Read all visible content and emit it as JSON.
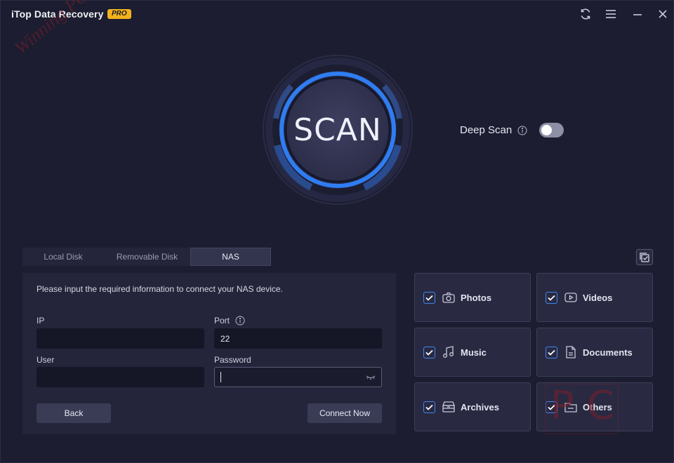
{
  "app": {
    "title": "iTop Data Recovery",
    "badge": "PRO"
  },
  "titlebar": {
    "refresh_icon": "refresh-icon",
    "menu_icon": "menu-icon",
    "minimize_icon": "minimize-icon",
    "close_icon": "close-icon"
  },
  "watermark": {
    "text": "Winning PC",
    "corner": "P C"
  },
  "scan": {
    "label": "SCAN",
    "ring_color": "#2f7df2"
  },
  "deep_scan": {
    "label": "Deep Scan",
    "enabled": false
  },
  "tabs": [
    {
      "label": "Local Disk",
      "active": false
    },
    {
      "label": "Removable Disk",
      "active": false
    },
    {
      "label": "NAS",
      "active": true
    }
  ],
  "nas": {
    "intro": "Please input the required information to connect your NAS device.",
    "ip_label": "IP",
    "ip_value": "",
    "port_label": "Port",
    "port_value": "22",
    "user_label": "User",
    "user_value": "",
    "password_label": "Password",
    "password_value": "",
    "back_label": "Back",
    "connect_label": "Connect Now"
  },
  "categories": [
    {
      "label": "Photos",
      "icon": "camera-icon",
      "checked": true
    },
    {
      "label": "Videos",
      "icon": "video-icon",
      "checked": true
    },
    {
      "label": "Music",
      "icon": "music-note-icon",
      "checked": true
    },
    {
      "label": "Documents",
      "icon": "document-icon",
      "checked": true
    },
    {
      "label": "Archives",
      "icon": "archive-icon",
      "checked": true
    },
    {
      "label": "Others",
      "icon": "folder-icon",
      "checked": true
    }
  ],
  "colors": {
    "accent": "#2f7df2",
    "badge": "#f2b21b",
    "background": "#1c1d30",
    "panel": "#24253a"
  }
}
